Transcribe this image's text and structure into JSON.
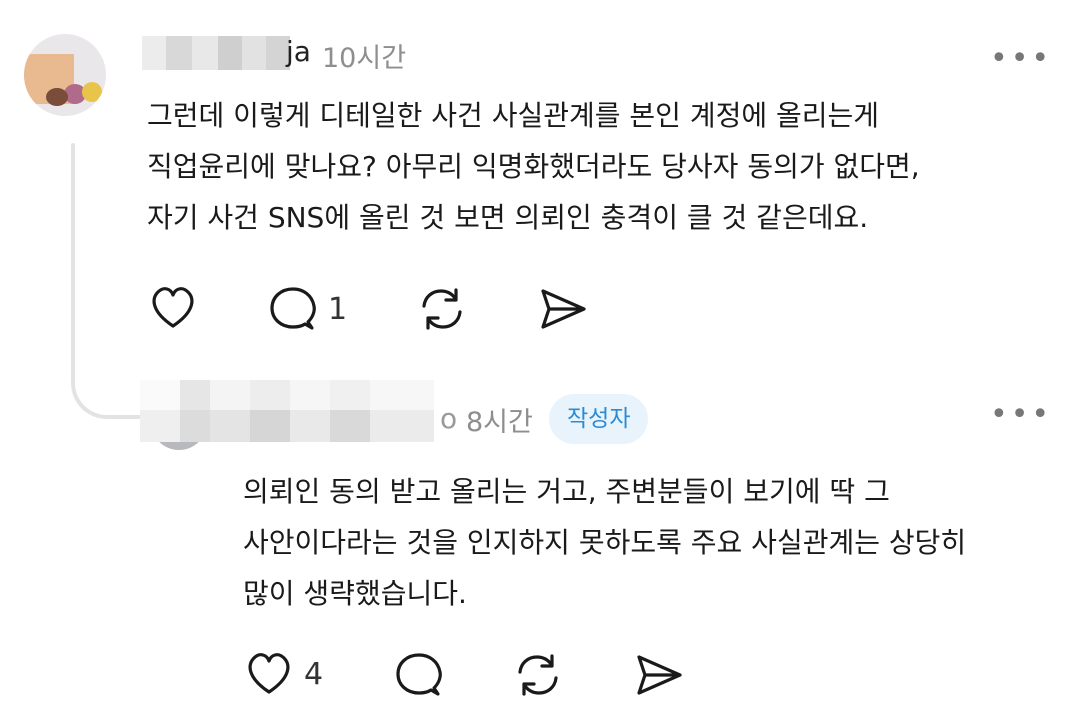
{
  "comments": [
    {
      "author_suffix": "ja",
      "time": "10시간",
      "lines": [
        "그런데 이렇게 디테일한 사건 사실관계를 본인 계정에 올리는게",
        "직업윤리에 맞나요?  아무리 익명화했더라도 당사자 동의가 없다면,",
        "자기 사건 SNS에 올린 것 보면 의뢰인 충격이 클 것 같은데요."
      ],
      "actions": {
        "like_count": "",
        "reply_count": "1",
        "like_icon": "heart-icon",
        "reply_icon": "comment-icon",
        "repost_icon": "repost-icon",
        "share_icon": "send-icon"
      }
    },
    {
      "author_suffix": "o",
      "time": "8시간",
      "badge": "작성자",
      "lines": [
        "의뢰인 동의 받고 올리는 거고, 주변분들이 보기에 딱 그",
        "사안이다라는 것을 인지하지 못하도록 주요 사실관계는 상당히",
        "많이 생략했습니다."
      ],
      "actions": {
        "like_count": "4",
        "reply_count": ""
      }
    }
  ],
  "more_glyph": "•••",
  "colors": {
    "badge_bg": "#e8f3fb",
    "badge_text": "#2a8bd6",
    "time_text": "#8e8e8e"
  }
}
